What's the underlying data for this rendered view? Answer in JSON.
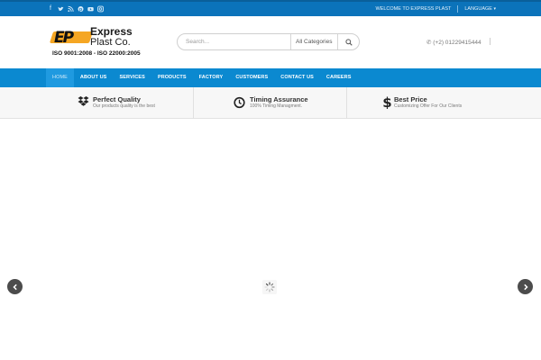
{
  "topbar": {
    "social_icons": [
      "facebook-icon",
      "twitter-icon",
      "rss-icon",
      "pinterest-icon",
      "youtube-icon",
      "instagram-icon"
    ],
    "welcome": "WELCOME TO EXPRESS PLAST",
    "language": "LANGUAGE",
    "bg_color": "#0b73ba"
  },
  "header": {
    "logo": {
      "word1": "Express",
      "word2": "Plast Co.",
      "iso": "ISO 9001:2008 - ISO 22000:2005",
      "accent": "#f5a623"
    },
    "search": {
      "placeholder": "Search...",
      "category": "All Categories"
    },
    "phone": "(+2) 01229415444"
  },
  "nav": {
    "bg_color": "#0b89d0",
    "items": [
      {
        "label": "HOME",
        "active": true
      },
      {
        "label": "ABOUT US"
      },
      {
        "label": "SERVICES"
      },
      {
        "label": "PRODUCTS"
      },
      {
        "label": "FACTORY"
      },
      {
        "label": "CUSTOMERS"
      },
      {
        "label": "CONTACT US"
      },
      {
        "label": "CAREERS"
      }
    ]
  },
  "features": [
    {
      "icon": "dropbox-icon",
      "title": "Perfect Quality",
      "subtitle": "Our products quality is the best"
    },
    {
      "icon": "clock-icon",
      "title": "Timing Assurance",
      "subtitle": "100% Timing Managment."
    },
    {
      "icon": "dollar-icon",
      "title": "Best Price",
      "subtitle": "Customizing Offer For Our Clients"
    }
  ],
  "slider": {
    "prev_icon": "chevron-left-icon",
    "next_icon": "chevron-right-icon",
    "loader_icon": "spinner-icon"
  }
}
